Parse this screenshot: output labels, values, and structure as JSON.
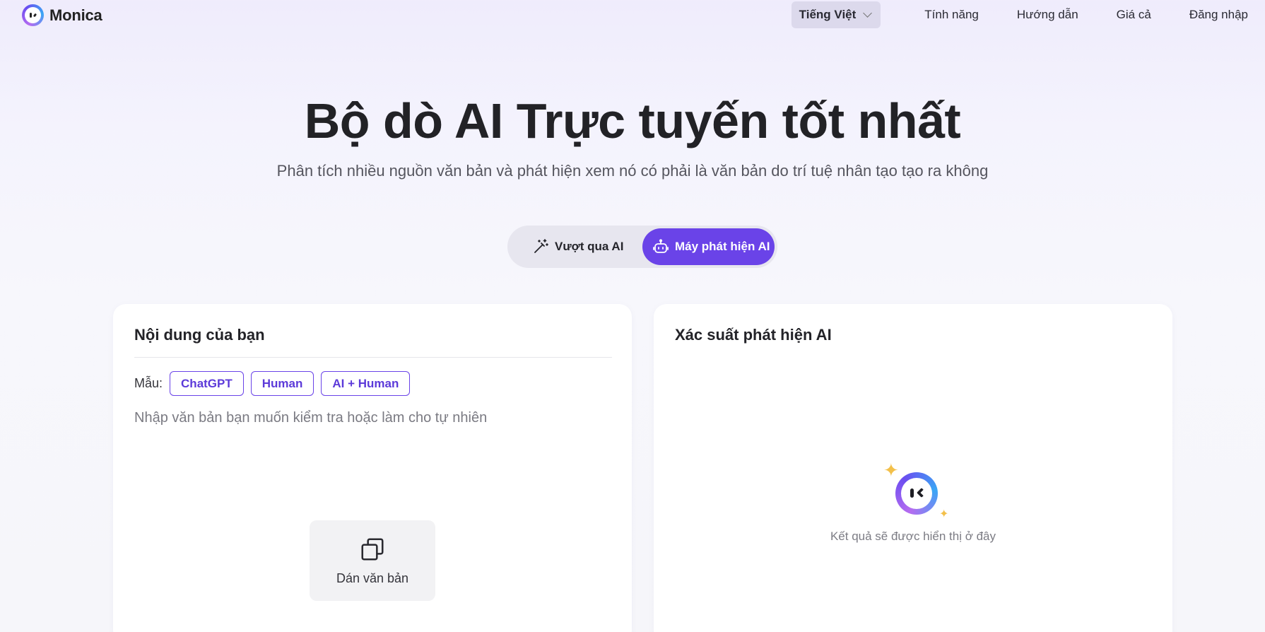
{
  "nav": {
    "brand": "Monica",
    "language": "Tiếng Việt",
    "links": [
      "Tính năng",
      "Hướng dẫn",
      "Giá cả",
      "Đăng nhập"
    ]
  },
  "hero": {
    "title": "Bộ dò AI Trực tuyến tốt nhất",
    "subtitle": "Phân tích nhiều nguồn văn bản và phát hiện xem nó có phải là văn bản do trí tuệ nhân tạo tạo ra không"
  },
  "mode_toggle": {
    "options": [
      "Vượt qua AI",
      "Máy phát hiện AI"
    ],
    "active": "Máy phát hiện AI",
    "accent_color": "#6a43e8"
  },
  "input_card": {
    "title": "Nội dung của bạn",
    "samples_label": "Mẫu:",
    "samples": [
      "ChatGPT",
      "Human",
      "AI + Human"
    ],
    "placeholder": "Nhập văn bản bạn muốn kiểm tra hoặc làm cho tự nhiên",
    "paste_label": "Dán văn bản",
    "paste_icon": "copy-icon"
  },
  "result_card": {
    "title": "Xác suất phát hiện AI",
    "empty_text": "Kết quả sẽ được hiển thị ở đây",
    "illustration": "monica-robot-icon"
  }
}
